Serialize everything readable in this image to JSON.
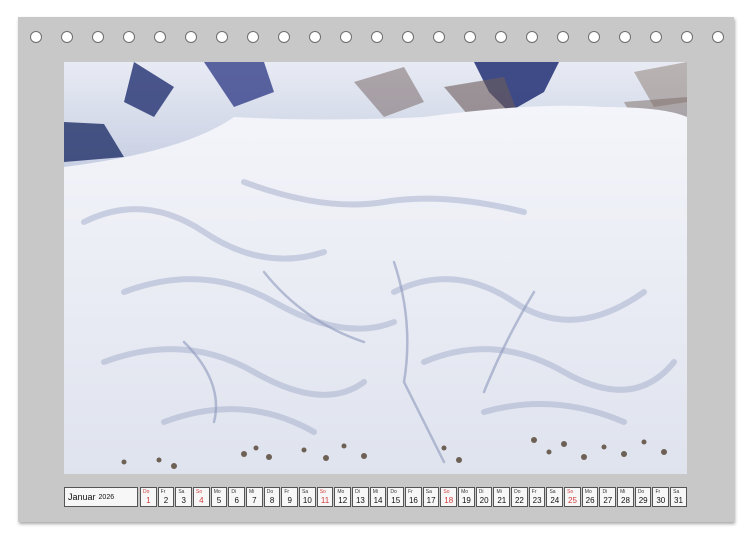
{
  "calendar": {
    "month": "Januar",
    "year": "2026",
    "days": [
      {
        "wd": "Do",
        "num": "1",
        "red": true
      },
      {
        "wd": "Fr",
        "num": "2",
        "red": false
      },
      {
        "wd": "Sa",
        "num": "3",
        "red": false
      },
      {
        "wd": "So",
        "num": "4",
        "red": true
      },
      {
        "wd": "Mo",
        "num": "5",
        "red": false
      },
      {
        "wd": "Di",
        "num": "6",
        "red": false
      },
      {
        "wd": "Mi",
        "num": "7",
        "red": false
      },
      {
        "wd": "Do",
        "num": "8",
        "red": false
      },
      {
        "wd": "Fr",
        "num": "9",
        "red": false
      },
      {
        "wd": "Sa",
        "num": "10",
        "red": false
      },
      {
        "wd": "So",
        "num": "11",
        "red": true
      },
      {
        "wd": "Mo",
        "num": "12",
        "red": false
      },
      {
        "wd": "Di",
        "num": "13",
        "red": false
      },
      {
        "wd": "Mi",
        "num": "14",
        "red": false
      },
      {
        "wd": "Do",
        "num": "15",
        "red": false
      },
      {
        "wd": "Fr",
        "num": "16",
        "red": false
      },
      {
        "wd": "Sa",
        "num": "17",
        "red": false
      },
      {
        "wd": "So",
        "num": "18",
        "red": true
      },
      {
        "wd": "Mo",
        "num": "19",
        "red": false
      },
      {
        "wd": "Di",
        "num": "20",
        "red": false
      },
      {
        "wd": "Mi",
        "num": "21",
        "red": false
      },
      {
        "wd": "Do",
        "num": "22",
        "red": false
      },
      {
        "wd": "Fr",
        "num": "23",
        "red": false
      },
      {
        "wd": "Sa",
        "num": "24",
        "red": false
      },
      {
        "wd": "So",
        "num": "25",
        "red": true
      },
      {
        "wd": "Mo",
        "num": "26",
        "red": false
      },
      {
        "wd": "Di",
        "num": "27",
        "red": false
      },
      {
        "wd": "Mi",
        "num": "28",
        "red": false
      },
      {
        "wd": "Do",
        "num": "29",
        "red": false
      },
      {
        "wd": "Fr",
        "num": "30",
        "red": false
      },
      {
        "wd": "Sa",
        "num": "31",
        "red": false
      }
    ]
  },
  "binding": {
    "hole_count": 23
  },
  "colors": {
    "page": "#c8c8c8",
    "weekend_red": "#d23c3c",
    "snow_shadow": "#9aa6c6",
    "rock": "#5a4a3a"
  }
}
